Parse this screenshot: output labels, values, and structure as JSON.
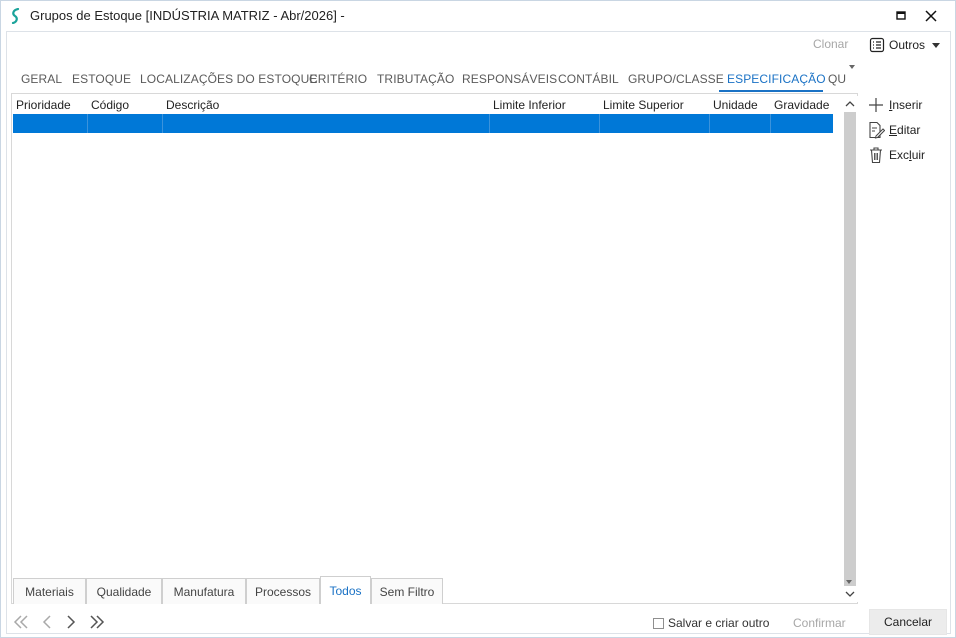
{
  "window": {
    "title": "Grupos de Estoque [INDÚSTRIA MATRIZ - Abr/2026]  -",
    "app_icon": "app-logo-icon",
    "controls": [
      "maximize-icon",
      "close-icon"
    ]
  },
  "toolbar": {
    "clonar_label": "Clonar",
    "outros_label": "Outros"
  },
  "tabs": [
    {
      "label": "GERAL"
    },
    {
      "label": "ESTOQUE"
    },
    {
      "label": "LOCALIZAÇÕES DO ESTOQUE"
    },
    {
      "label": "CRITÉRIO"
    },
    {
      "label": "TRIBUTAÇÃO"
    },
    {
      "label": "RESPONSÁVEIS"
    },
    {
      "label": "CONTÁBIL"
    },
    {
      "label": "GRUPO/CLASSE"
    },
    {
      "label": "ESPECIFICAÇÃO",
      "active": true
    },
    {
      "label": "QU"
    }
  ],
  "grid": {
    "columns": [
      "Prioridade",
      "Código",
      "Descrição",
      "Limite Inferior",
      "Limite Superior",
      "Unidade",
      "Gravidade"
    ],
    "rows": [
      {
        "selected": true,
        "cells": [
          "",
          "",
          "",
          "",
          "",
          "",
          ""
        ]
      }
    ]
  },
  "side_actions": {
    "inserir": {
      "accel": "I",
      "rest": "nserir",
      "icon": "plus-icon"
    },
    "editar": {
      "accel": "E",
      "rest": "ditar",
      "icon": "edit-icon"
    },
    "excluir": {
      "pre": "Exc",
      "accel": "l",
      "rest": "uir",
      "icon": "trash-icon"
    }
  },
  "filter_tabs": [
    {
      "label": "Materiais"
    },
    {
      "label": "Qualidade"
    },
    {
      "label": "Manufatura"
    },
    {
      "label": "Processos"
    },
    {
      "label": "Todos",
      "active": true
    },
    {
      "label": "Sem Filtro"
    }
  ],
  "footer": {
    "save_and_create_label": "Salvar e criar outro",
    "save_and_create_checked": false,
    "confirmar_label": "Confirmar",
    "cancelar_label": "Cancelar"
  },
  "colors": {
    "accent": "#1a72c5",
    "selection": "#0078d7",
    "disabled_text": "#a7a7a7",
    "logo": "#1aa39a"
  }
}
